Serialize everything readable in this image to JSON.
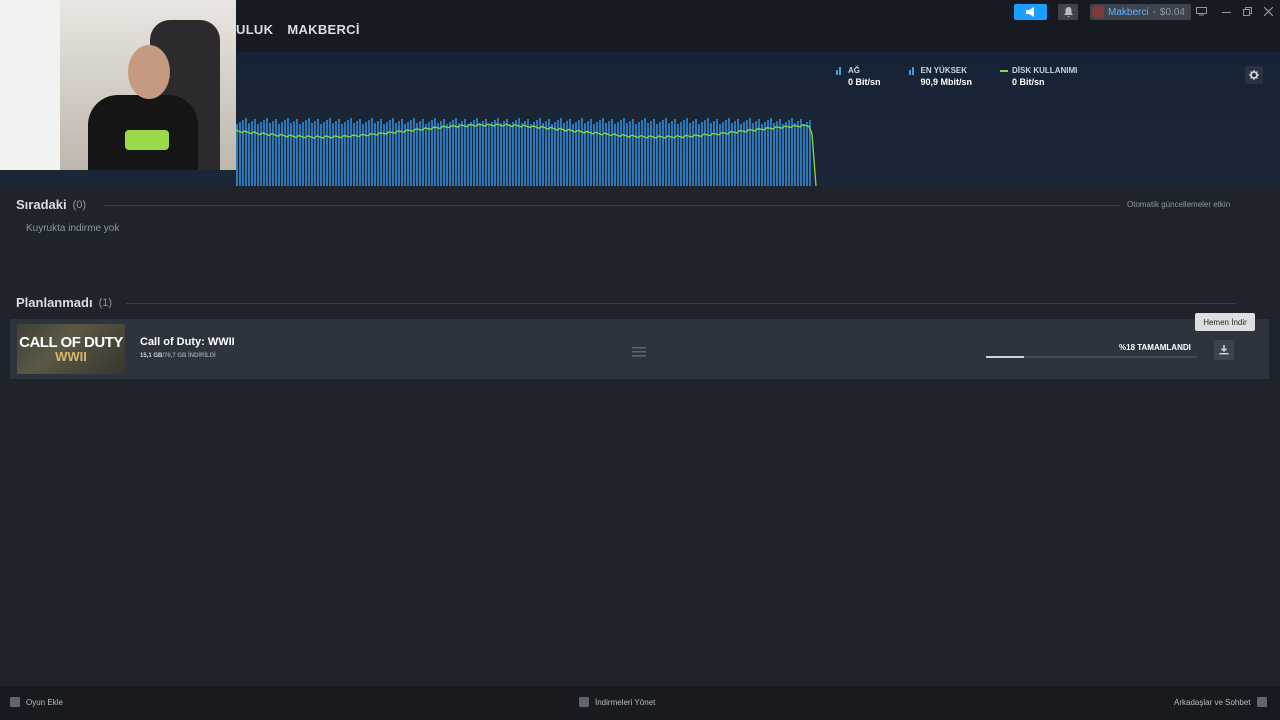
{
  "nav": {
    "items": [
      "ULUK",
      "MAKBERCİ"
    ]
  },
  "account": {
    "name": "Makberci",
    "separator": "-",
    "wallet": "$0.04"
  },
  "stats": {
    "network": {
      "label": "AĞ",
      "value": "0 Bit/sn",
      "color": "#4a9bd6"
    },
    "peak": {
      "label": "EN YÜKSEK",
      "value": "90,9 Mbit/sn",
      "color": "#4a9bd6"
    },
    "disk": {
      "label": "DİSK KULLANIMI",
      "value": "0 Bit/sn",
      "color": "#8bd64a"
    }
  },
  "queue": {
    "title": "Sıradaki",
    "count": "(0)",
    "empty_text": "Kuyrukta indirme yok",
    "auto_updates": "Otomatik güncellemeler etkin"
  },
  "unscheduled": {
    "title": "Planlanmadı",
    "count": "(1)",
    "items": [
      {
        "art_line1": "CALL OF DUTY",
        "art_line2": "WWII",
        "title": "Call of Duty: WWII",
        "downloaded": "15,1 GB",
        "total": "/76,7 GB İNDİRİLDİ",
        "progress_label": "%18 TAMAMLANDI",
        "progress": 0.18
      }
    ]
  },
  "tooltip": {
    "download_now": "Hemen İndir"
  },
  "footer": {
    "add_game": "Oyun Ekle",
    "manage_downloads": "İndirmeleri Yönet",
    "friends_chat": "Arkadaşlar ve Sohbet"
  }
}
